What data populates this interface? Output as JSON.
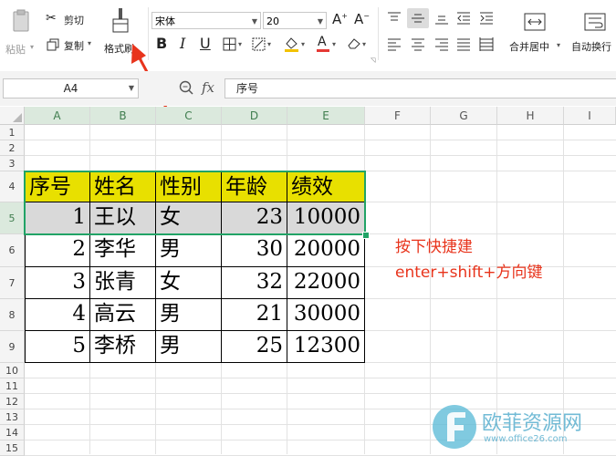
{
  "ribbon": {
    "paste_label": "粘贴",
    "cut_label": "剪切",
    "copy_label": "复制",
    "format_painter_label": "格式刷",
    "font_name": "宋体",
    "font_size": "20",
    "merge_center_label": "合并居中",
    "auto_wrap_label": "自动换行",
    "font_color": "#e53935",
    "highlight_color": "#f2c200"
  },
  "formula_bar": {
    "cell_ref": "A4",
    "fx_label": "fx",
    "content": "序号"
  },
  "sheet": {
    "columns": [
      "A",
      "B",
      "C",
      "D",
      "E",
      "F",
      "G",
      "H",
      "I"
    ],
    "rows": [
      "1",
      "2",
      "3",
      "4",
      "5",
      "6",
      "7",
      "8",
      "9",
      "10",
      "11",
      "12",
      "13",
      "14",
      "15"
    ],
    "selected_row": "5",
    "table_header": [
      "序号",
      "姓名",
      "性别",
      "年龄",
      "绩效"
    ],
    "table_rows": [
      [
        "1",
        "王以",
        "女",
        "23",
        "10000"
      ],
      [
        "2",
        "李华",
        "男",
        "30",
        "20000"
      ],
      [
        "3",
        "张青",
        "女",
        "32",
        "22000"
      ],
      [
        "4",
        "高云",
        "男",
        "21",
        "30000"
      ],
      [
        "5",
        "李桥",
        "男",
        "25",
        "12300"
      ]
    ]
  },
  "annotation": {
    "line1": "按下快捷建",
    "line2": "enter+shift+方向键",
    "color": "#e8341c"
  },
  "watermark": {
    "text": "欧菲资源网",
    "url": "www.office26.com"
  },
  "colors": {
    "header_fill": "#e8e000",
    "selection_fill": "#d9d9d9",
    "selection_border": "#21a366"
  }
}
